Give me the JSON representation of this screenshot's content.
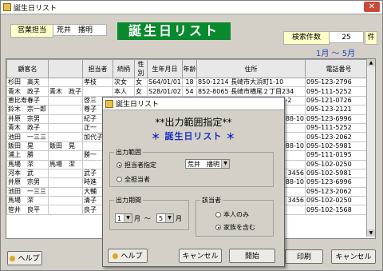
{
  "window": {
    "title": "誕生日リスト",
    "close": "✕"
  },
  "header": {
    "sales_label": "営業担当",
    "sales_value": "荒井　播明",
    "big_title": "誕生日リスト",
    "count_label": "検索件数",
    "count_value": "25",
    "count_unit": "件",
    "range": "1月 ～ 5月"
  },
  "table": {
    "columns": [
      "顧客名",
      "",
      "担当者",
      "続柄",
      "性別",
      "生年月日",
      "年齢",
      "住所",
      "電話番号"
    ],
    "rows": [
      [
        "杉田　高夫",
        "",
        "孝枝",
        "次女",
        "女",
        "S64/01/01",
        "18",
        "850-1214 長崎市大浜町1-10",
        "095-123-2796"
      ],
      [
        "青木　政子",
        "青木　政子",
        "",
        "本人",
        "女",
        "S28/01/02",
        "54",
        "852-8065 長崎市横尾２丁目234",
        "095-111-5252"
      ],
      [
        "恵比寿春子",
        "",
        "啓三",
        "配偶者",
        "男",
        "S23/02/08",
        "59",
        "851-2206 長崎市三京町1414-2",
        "095-121-0726"
      ],
      [
        "鈴木　宗一郎",
        "",
        "尊子",
        "",
        "",
        "",
        "",
        "",
        "095-123-2121"
      ],
      [
        "井原　宗男",
        "",
        "紀子",
        "",
        "",
        "",
        "",
        "",
        "095-123-6996"
      ],
      [
        "青木　政子",
        "",
        "正一",
        "",
        "",
        "",
        "",
        "",
        "095-111-5252"
      ],
      [
        "池田　一三三",
        "",
        "加代子",
        "",
        "",
        "",
        "",
        "",
        "095-123-2062"
      ],
      [
        "飯田　晃",
        "飯田　晃",
        "",
        "",
        "",
        "",
        "",
        "",
        "095-102-5981"
      ],
      [
        "浦上　勝",
        "",
        "勝一",
        "",
        "",
        "",
        "",
        "",
        "095-111-0195"
      ],
      [
        "馬場　潔",
        "馬場　潔",
        "",
        "",
        "",
        "",
        "",
        "",
        "095-102-0250"
      ],
      [
        "河本　武",
        "",
        "武子",
        "",
        "",
        "",
        "",
        "",
        "095-102-5981"
      ],
      [
        "井原　宗男",
        "",
        "時進",
        "",
        "",
        "",
        "",
        "",
        "095-123-6996"
      ],
      [
        "池田　一三三",
        "",
        "大輔",
        "",
        "",
        "",
        "",
        "",
        "095-123-2062"
      ],
      [
        "馬場　潔",
        "",
        "清子",
        "",
        "",
        "",
        "",
        "",
        "095-102-0250"
      ],
      [
        "笹井　良平",
        "",
        "良子",
        "",
        "",
        "",
        "",
        "",
        "095-102-1568"
      ]
    ],
    "partial_cells": [
      {
        "row": 4,
        "text": "88-10"
      },
      {
        "row": 7,
        "text": "88-10"
      },
      {
        "row": 10,
        "text": "3456"
      },
      {
        "row": 11,
        "text": "88-10"
      },
      {
        "row": 13,
        "text": "3456"
      }
    ]
  },
  "bottom": {
    "help": "ヘルプ",
    "print": "印刷",
    "cancel": "キャンセル"
  },
  "dialog": {
    "title": "誕生日リスト",
    "heading": "**出力範囲指定**",
    "subheading": "＊ 誕生日リスト ＊",
    "range_group": "出力範囲",
    "radio_person": "担当者指定",
    "person_value": "荒井　播明",
    "radio_all": "全担当者",
    "period_group": "出力期間",
    "from_month": "1",
    "to_month": "5",
    "month_unit": "月",
    "tilde": "～",
    "who_group": "該当者",
    "radio_self": "本人のみ",
    "radio_family": "家族を含む",
    "help": "ヘルプ",
    "cancel": "キャンセル",
    "start": "開始"
  }
}
